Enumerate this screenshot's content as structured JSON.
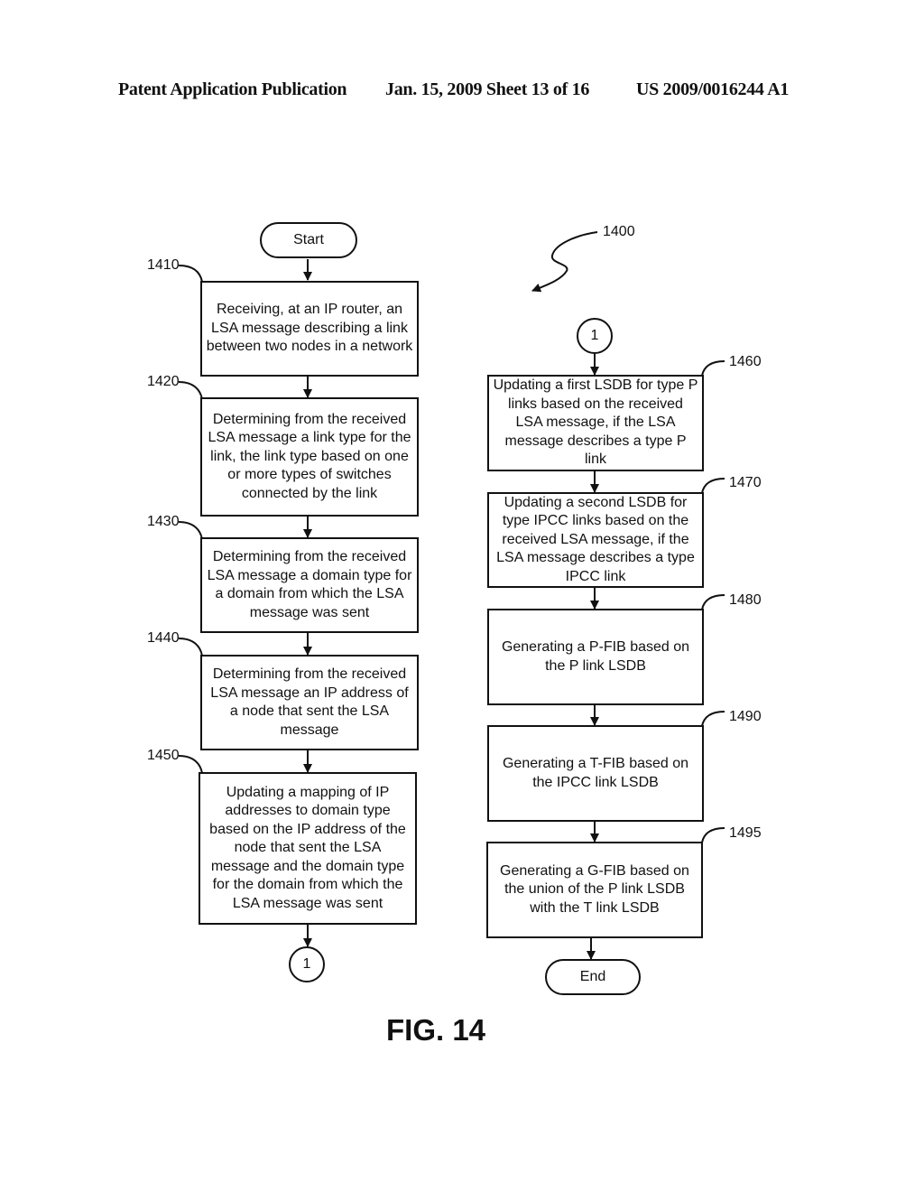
{
  "header": {
    "publication": "Patent Application Publication",
    "date_sheet": "Jan. 15, 2009  Sheet 13 of 16",
    "patent_number": "US 2009/0016244 A1"
  },
  "figure": {
    "label": "FIG. 14",
    "ref": "1400"
  },
  "flow": {
    "start": "Start",
    "end": "End",
    "connector": "1",
    "steps": [
      {
        "ref": "1410",
        "text": "Receiving, at an IP router, an LSA message describing a link between two nodes in a network"
      },
      {
        "ref": "1420",
        "text": "Determining from the received LSA message a link type for the link, the link type based on one or more types of switches connected by the link"
      },
      {
        "ref": "1430",
        "text": "Determining from the received LSA message a domain type for a domain from which the LSA message was sent"
      },
      {
        "ref": "1440",
        "text": "Determining from the received LSA message an IP address of a node that sent the LSA message"
      },
      {
        "ref": "1450",
        "text": "Updating a mapping of IP addresses to domain type based on the IP address of the node that sent the LSA message and the domain type for the domain from which the LSA message was sent"
      },
      {
        "ref": "1460",
        "text": "Updating a first LSDB for type P links based on the received LSA message, if the LSA message describes a type P link"
      },
      {
        "ref": "1470",
        "text": "Updating a second LSDB for type IPCC links based on the received LSA message, if the LSA message describes a type IPCC link"
      },
      {
        "ref": "1480",
        "text": "Generating a P-FIB based on the P link LSDB"
      },
      {
        "ref": "1490",
        "text": "Generating a T-FIB based on the IPCC link LSDB"
      },
      {
        "ref": "1495",
        "text": "Generating a G-FIB based on the union of the P link LSDB with the T link LSDB"
      }
    ]
  }
}
